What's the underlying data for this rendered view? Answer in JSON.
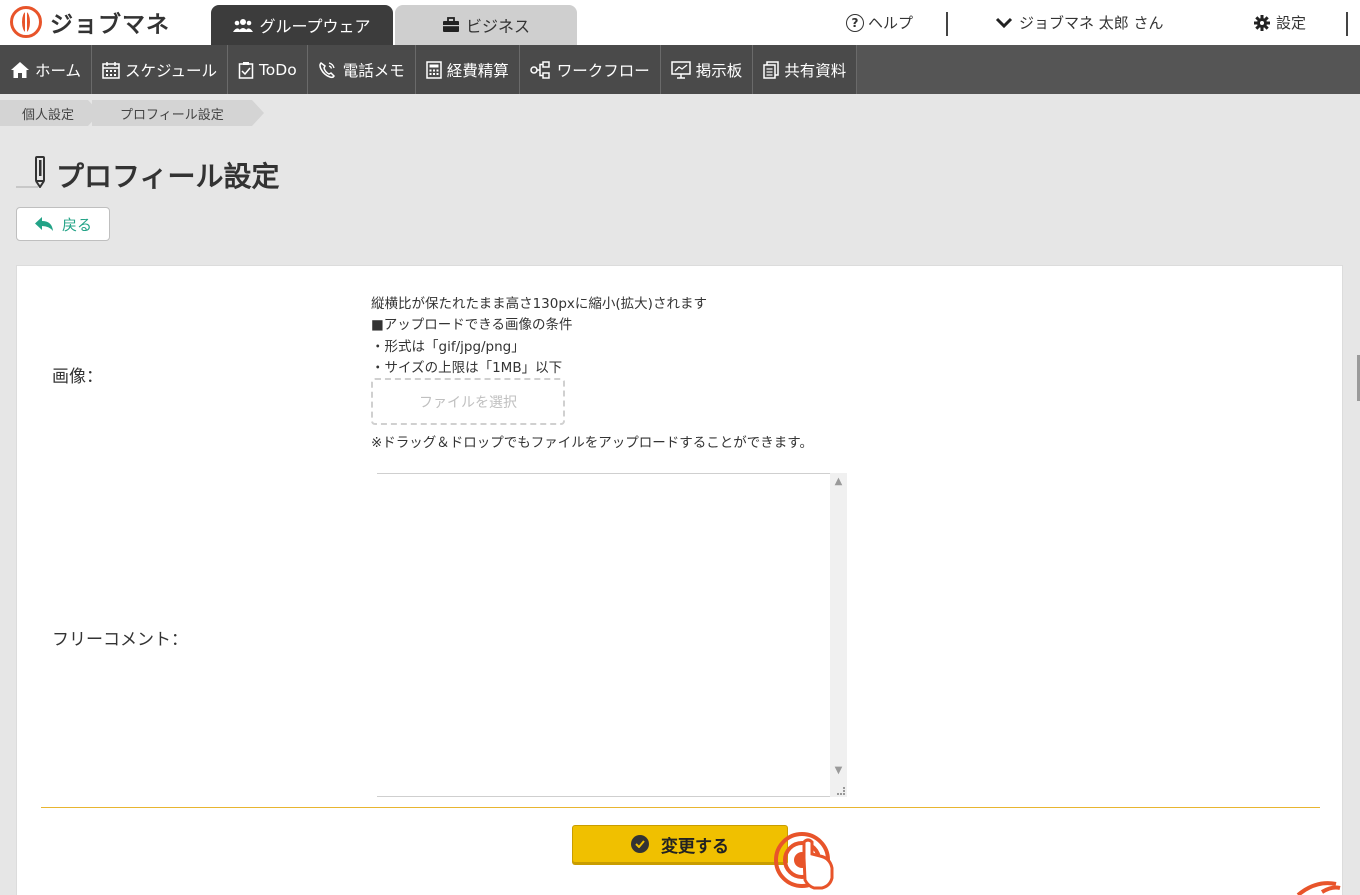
{
  "app": {
    "name": "ジョブマネ",
    "brand_color": "#e8542a"
  },
  "tabs": [
    {
      "label": "グループウェア",
      "icon": "group-icon",
      "active": true
    },
    {
      "label": "ビジネス",
      "icon": "briefcase-icon",
      "active": false
    }
  ],
  "header": {
    "help_label": "ヘルプ",
    "user_label": "ジョブマネ 太郎 さん",
    "settings_label": "設定"
  },
  "nav": [
    {
      "label": "ホーム",
      "icon": "home-icon"
    },
    {
      "label": "スケジュール",
      "icon": "calendar-icon"
    },
    {
      "label": "ToDo",
      "icon": "clipboard-icon"
    },
    {
      "label": "電話メモ",
      "icon": "phone-icon"
    },
    {
      "label": "経費精算",
      "icon": "calculator-icon"
    },
    {
      "label": "ワークフロー",
      "icon": "workflow-icon"
    },
    {
      "label": "掲示板",
      "icon": "board-icon"
    },
    {
      "label": "共有資料",
      "icon": "documents-icon"
    }
  ],
  "breadcrumb": [
    "個人設定",
    "プロフィール設定"
  ],
  "page": {
    "title": "プロフィール設定",
    "back_label": "戻る"
  },
  "form": {
    "image_label": "画像：",
    "image_notes": [
      "縦横比が保たれたまま高さ130pxに縮小(拡大)されます",
      "■アップロードできる画像の条件",
      "・形式は「gif/jpg/png」",
      "・サイズの上限は「1MB」以下"
    ],
    "file_select_label": "ファイルを選択",
    "dnd_note": "※ドラッグ＆ドロップでもファイルをアップロードすることができます。",
    "comment_label": "フリーコメント：",
    "comment_value": "",
    "submit_label": "変更する"
  }
}
